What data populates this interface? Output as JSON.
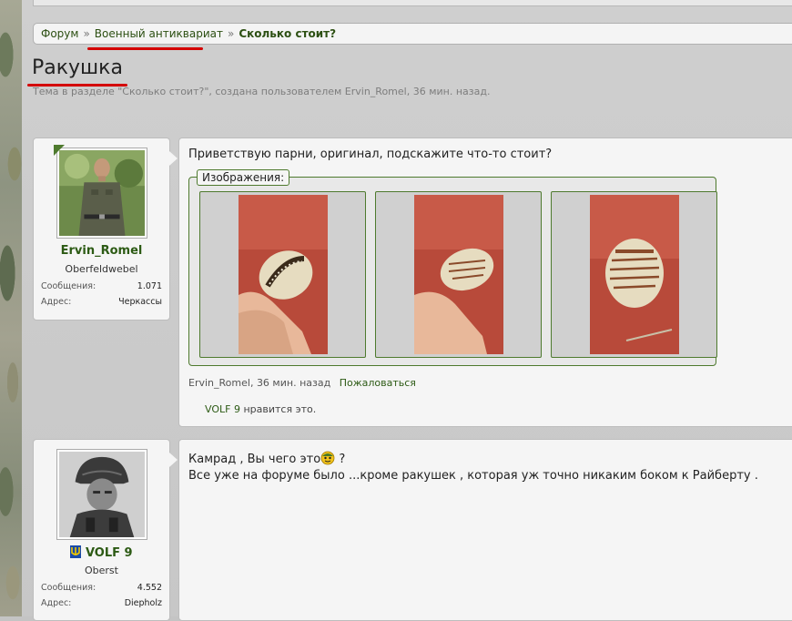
{
  "breadcrumb": {
    "items": [
      "Форум",
      "Военный антиквариат",
      "Сколько стоит?"
    ],
    "separator": "»"
  },
  "thread": {
    "title": "Ракушка",
    "description": "Тема в разделе \"Сколько стоит?\", создана пользователем Ervin_Romel, 36 мин. назад."
  },
  "posts": [
    {
      "author": {
        "name": "Ervin_Romel",
        "rank": "Oberfeldwebel",
        "stats": [
          {
            "label": "Сообщения:",
            "value": "1.071"
          },
          {
            "label": "Адрес:",
            "value": "Черкассы"
          }
        ]
      },
      "text": "Приветствую парни, оригинал, подскажите что-то стоит?",
      "attachments_label": "Изображения:",
      "meta": {
        "author": "Ervin_Romel",
        "time": "36 мин. назад",
        "report_label": "Пожаловаться"
      },
      "likes": {
        "user": "VOLF 9",
        "suffix": "нравится это."
      }
    },
    {
      "author": {
        "name": "VOLF 9",
        "rank": "Oberst",
        "stats": [
          {
            "label": "Сообщения:",
            "value": "4.552"
          },
          {
            "label": "Адрес:",
            "value": "Diepholz"
          }
        ]
      },
      "text_before_smiley": "Камрад , Вы чего это",
      "text_after_smiley": " ?",
      "text_line2": "Все уже на форуме было ...кроме ракушек , которая уж точно никаким боком к Райберту ."
    }
  ],
  "colors": {
    "accent": "#2c5a14",
    "border_green": "#4e7a2e",
    "highlight_red": "#d40000"
  },
  "icons": {
    "post2_user_badge": "trident-icon",
    "post2_smiley": "smiley-icon"
  }
}
